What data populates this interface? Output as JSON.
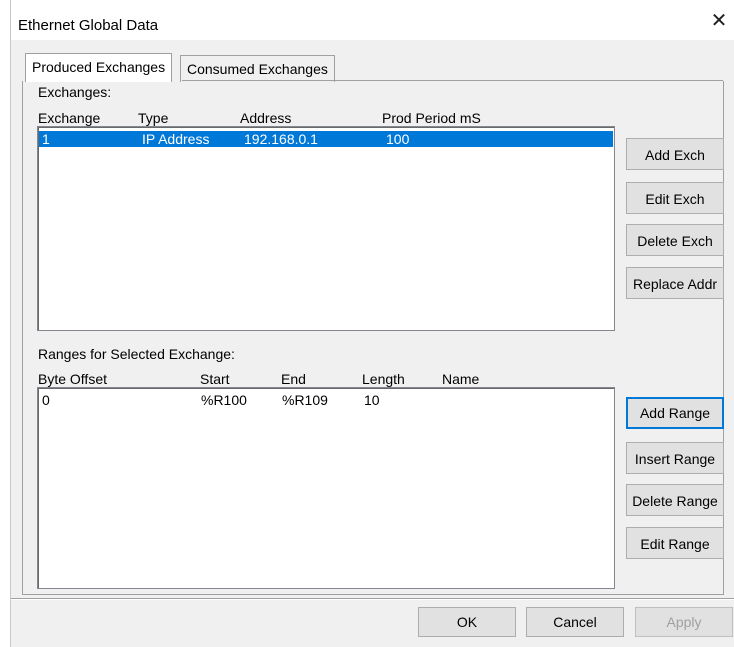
{
  "window": {
    "title": "Ethernet Global Data",
    "close_glyph": "✕"
  },
  "tabs": [
    {
      "label": "Produced Exchanges",
      "active": true
    },
    {
      "label": "Consumed Exchanges",
      "active": false
    }
  ],
  "exchanges": {
    "label": "Exchanges:",
    "columns": [
      "Exchange",
      "Type",
      "Address",
      "Prod Period mS"
    ],
    "rows": [
      {
        "exchange": "1",
        "type": "IP Address",
        "address": "192.168.0.1",
        "period": "100",
        "selected": true
      }
    ],
    "buttons": {
      "add": "Add Exch",
      "edit": "Edit Exch",
      "delete": "Delete Exch",
      "replace": "Replace Addr"
    }
  },
  "ranges": {
    "label": "Ranges for Selected Exchange:",
    "columns": [
      "Byte Offset",
      "Start",
      "End",
      "Length",
      "Name"
    ],
    "rows": [
      {
        "offset": "0",
        "start": "%R100",
        "end": "%R109",
        "length": "10",
        "name": ""
      }
    ],
    "buttons": {
      "add": "Add Range",
      "insert": "Insert Range",
      "delete": "Delete Range",
      "edit": "Edit Range"
    }
  },
  "footer": {
    "ok": "OK",
    "cancel": "Cancel",
    "apply": "Apply"
  },
  "colors": {
    "selection": "#0078d7",
    "dialog_bg": "#f0f0f0",
    "focus_border": "#0078d7"
  }
}
